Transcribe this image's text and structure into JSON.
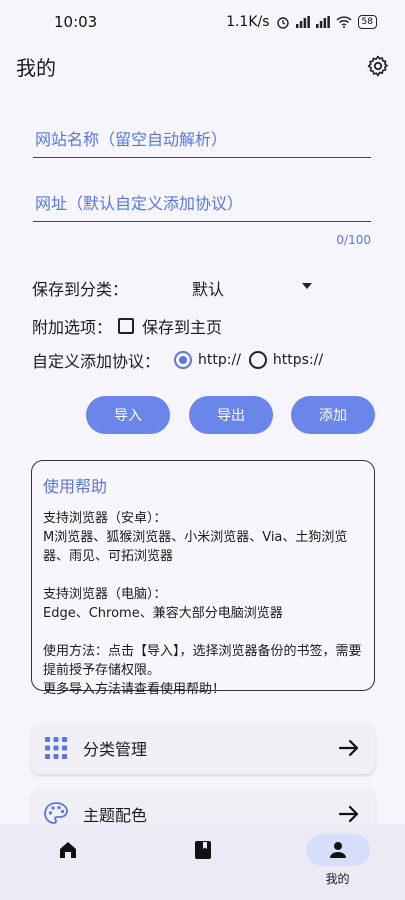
{
  "status": {
    "time": "10:03",
    "speed": "1.1K/s",
    "battery": "58"
  },
  "header": {
    "title": "我的"
  },
  "form": {
    "name_placeholder": "网站名称（留空自动解析）",
    "url_placeholder": "网址（默认自定义添加协议）",
    "counter": "0/100",
    "category_label": "保存到分类：",
    "category_value": "默认",
    "extra_label": "附加选项：",
    "save_home_label": "保存到主页",
    "protocol_label": "自定义添加协议：",
    "protocol_options": [
      "http://",
      "https://"
    ],
    "protocol_selected": "http://"
  },
  "actions": {
    "import": "导入",
    "export": "导出",
    "add": "添加"
  },
  "help": {
    "title": "使用帮助",
    "android_title": "支持浏览器（安卓）：",
    "android_list": "M浏览器、狐猴浏览器、小米浏览器、Via、土狗浏览器、雨见、可拓浏览器",
    "pc_title": "支持浏览器（电脑）：",
    "pc_list": "Edge、Chrome、兼容大部分电脑浏览器",
    "usage": "使用方法：点击【导入】，选择浏览器备份的书签，需要提前授予存储权限。",
    "more": "更多导入方法请查看使用帮助！"
  },
  "menu": [
    {
      "label": "分类管理",
      "icon": "grid-icon"
    },
    {
      "label": "主题配色",
      "icon": "palette-icon"
    }
  ],
  "nav": [
    {
      "label": "",
      "icon": "home-icon"
    },
    {
      "label": "",
      "icon": "book-icon"
    },
    {
      "label": "我的",
      "icon": "person-icon"
    }
  ],
  "colors": {
    "accent": "#5b76e0",
    "button": "#6b86ea",
    "nav_active": "#d6defb"
  }
}
